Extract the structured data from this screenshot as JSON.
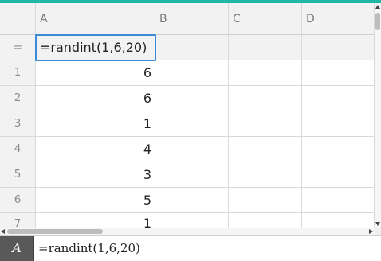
{
  "columns": [
    "A",
    "B",
    "C",
    "D"
  ],
  "formula_row": {
    "symbol": "=",
    "cell_a": "=randint(1,6,20)"
  },
  "rows": [
    {
      "num": "1",
      "a": "6"
    },
    {
      "num": "2",
      "a": "6"
    },
    {
      "num": "3",
      "a": "1"
    },
    {
      "num": "4",
      "a": "4"
    },
    {
      "num": "5",
      "a": "3"
    },
    {
      "num": "6",
      "a": "5"
    },
    {
      "num": "7",
      "a": "1"
    }
  ],
  "entry_line": {
    "cell_ref": "A",
    "text": "=randint(1,6,20)"
  },
  "colors": {
    "accent": "#1fb8a5",
    "selection": "#3b8ad8",
    "entry_ref_bg": "#595959",
    "header_bg": "#f2f2f2"
  }
}
